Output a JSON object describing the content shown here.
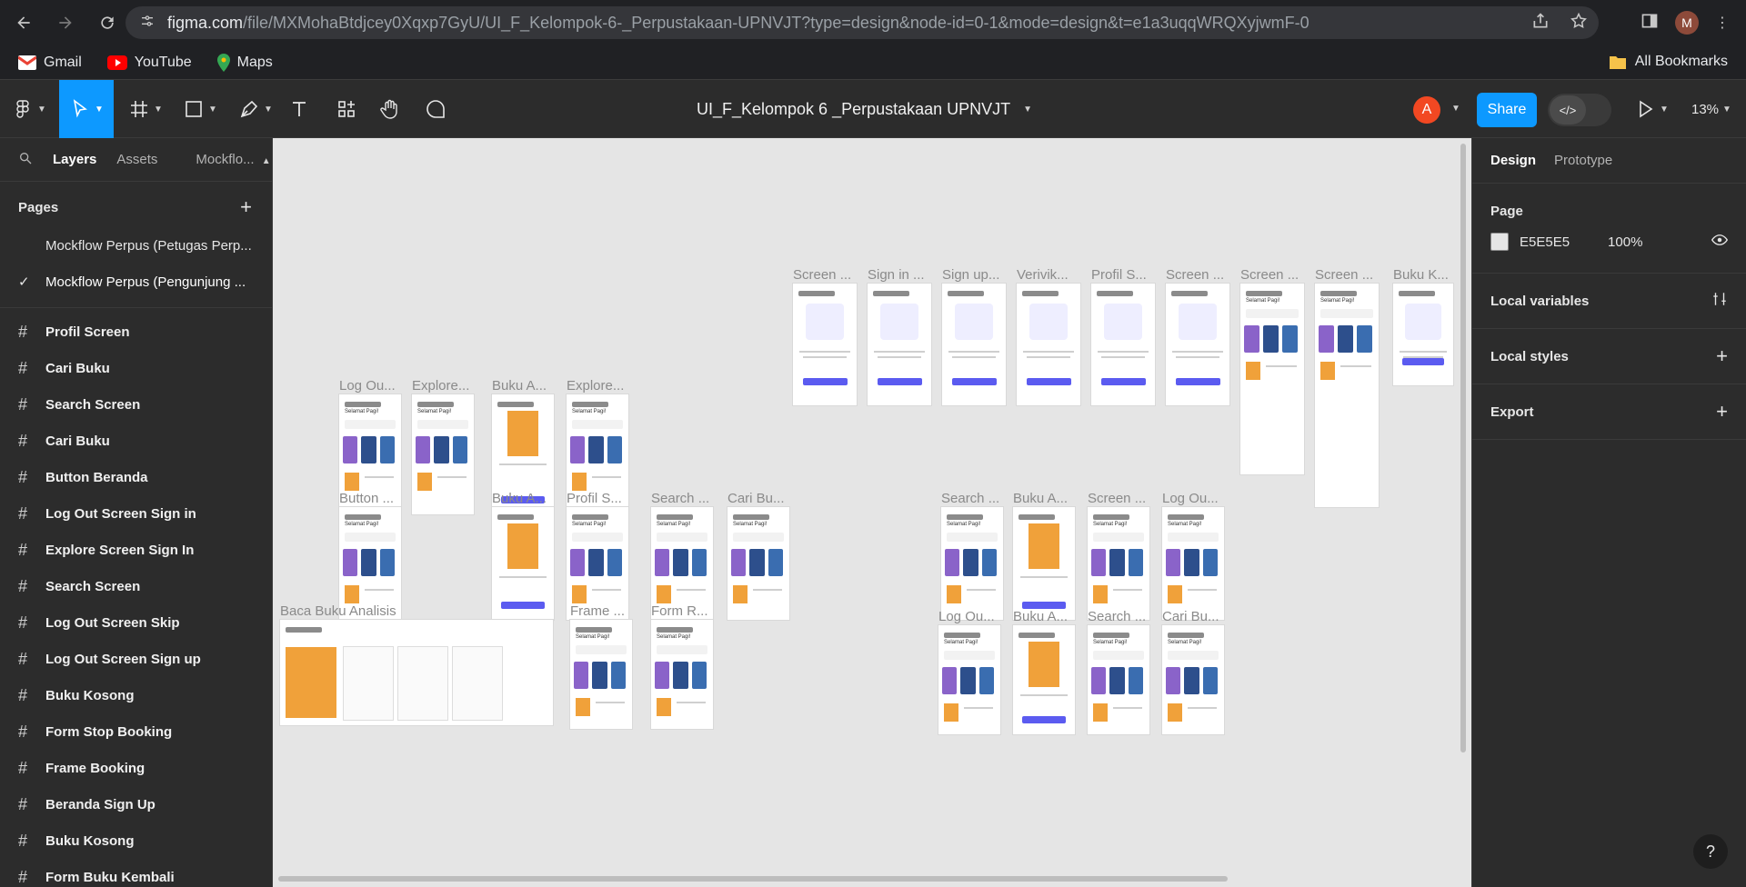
{
  "browser": {
    "url_main": "figma.com",
    "url_rest": "/file/MXMohaBtdjcey0Xqxp7GyU/UI_F_Kelompok-6-_Perpustakaan-UPNVJT?type=design&node-id=0-1&mode=design&t=e1a3uqqWRQXyjwmF-0",
    "profile_initial": "M"
  },
  "bookmarks": {
    "items": [
      "Gmail",
      "YouTube",
      "Maps"
    ],
    "all": "All Bookmarks"
  },
  "toolbar": {
    "file_title": "UI_F_Kelompok 6 _Perpustakaan UPNVJT",
    "user_initial": "A",
    "share_label": "Share",
    "zoom": "13%",
    "dev_mode_icon": "</>"
  },
  "left_panel": {
    "tabs": [
      "Layers",
      "Assets",
      "Mockflo..."
    ],
    "pages_header": "Pages",
    "pages": [
      "Mockflow Perpus (Petugas Perp...",
      "Mockflow Perpus (Pengunjung ..."
    ],
    "layers": [
      "Profil Screen",
      "Cari Buku",
      "Search Screen",
      "Cari Buku",
      "Button Beranda",
      "Log Out Screen Sign in",
      "Explore Screen Sign In",
      "Search Screen",
      "Log Out Screen Skip",
      "Log Out Screen Sign up",
      "Buku Kosong",
      "Form Stop Booking",
      "Frame Booking",
      "Beranda Sign Up",
      "Buku Kosong",
      "Form Buku Kembali"
    ]
  },
  "canvas": {
    "labels": {
      "l1": "Screen ...",
      "l2": "Sign in ...",
      "l3": "Sign up...",
      "l4": "Verivik...",
      "l5": "Profil S...",
      "l6": "Screen ...",
      "l7": "Screen ...",
      "l8": "Screen ...",
      "l9": "Buku K...",
      "l10": "Log Ou...",
      "l11": "Explore...",
      "l12": "Buku A...",
      "l13": "Explore...",
      "l14": "Button ...",
      "l15": "Buku A...",
      "l16": "Profil S...",
      "l17": "Search ...",
      "l18": "Cari Bu...",
      "l19": "Search ...",
      "l20": "Buku A...",
      "l21": "Screen ...",
      "l22": "Log Ou...",
      "l23": "Baca Buku Analisis",
      "l24": "Frame ...",
      "l25": "Form R...",
      "l26": "Log Ou...",
      "l27": "Buku A...",
      "l28": "Search ...",
      "l29": "Cari Bu..."
    },
    "greeting": "Selamat Pagi!"
  },
  "right_panel": {
    "tabs": [
      "Design",
      "Prototype"
    ],
    "page_title": "Page",
    "page_color": "E5E5E5",
    "page_opacity": "100%",
    "local_variables": "Local variables",
    "local_styles": "Local styles",
    "export": "Export"
  },
  "colors": {
    "accent": "#0d99ff",
    "canvas_bg": "#e5e5e5",
    "mock_button": "#5b5bf0",
    "book_cover": "#f0a13a"
  },
  "help": "?"
}
